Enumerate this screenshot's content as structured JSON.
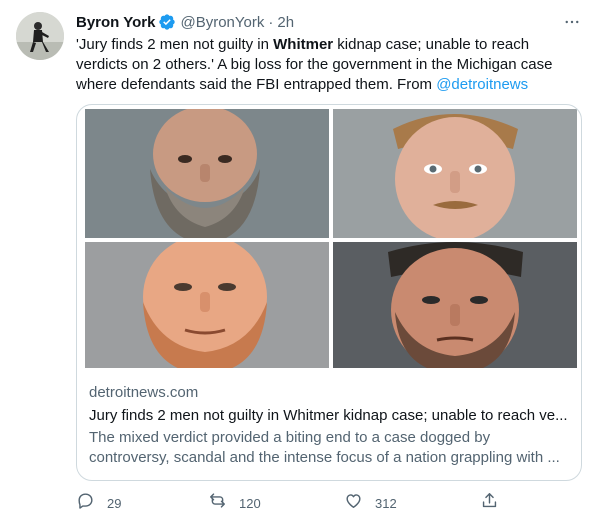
{
  "tweet": {
    "author_name": "Byron York",
    "handle": "@ByronYork",
    "separator": "·",
    "time": "2h",
    "text_part1": "'Jury finds 2 men not guilty in ",
    "text_bold": "Whitmer",
    "text_part2": " kidnap case; unable to reach verdicts on 2 others.' A big loss for the government in the Michigan case where defendants said the FBI entrapped them. From ",
    "mention": "@detroitnews"
  },
  "card": {
    "domain": "detroitnews.com",
    "title": "Jury finds 2 men not guilty in Whitmer kidnap case; unable to reach ve...",
    "description": "The mixed verdict provided a biting end to a case dogged by controversy, scandal and the intense focus of a nation grappling with ..."
  },
  "actions": {
    "reply_count": "29",
    "retweet_count": "120",
    "like_count": "312"
  },
  "icons": {
    "verified": "verified-badge-icon",
    "more": "more-icon",
    "reply": "reply-icon",
    "retweet": "retweet-icon",
    "like": "like-icon",
    "share": "share-icon"
  },
  "colors": {
    "accent": "#1d9bf0",
    "text": "#0f1419",
    "secondary": "#536471",
    "border": "#cfd9de"
  }
}
